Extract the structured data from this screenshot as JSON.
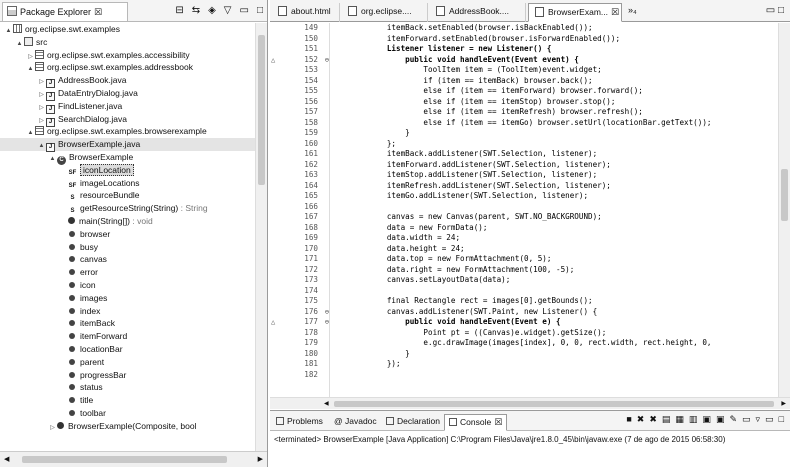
{
  "package_explorer": {
    "title": "Package Explorer",
    "tree": [
      {
        "indent": 0,
        "arrow": "▲",
        "icon": "proj",
        "label": "org.eclipse.swt.examples"
      },
      {
        "indent": 1,
        "arrow": "▲",
        "icon": "src",
        "label": "src"
      },
      {
        "indent": 2,
        "arrow": "▷",
        "icon": "pkg",
        "label": "org.eclipse.swt.examples.accessibility"
      },
      {
        "indent": 2,
        "arrow": "▲",
        "icon": "pkg",
        "label": "org.eclipse.swt.examples.addressbook"
      },
      {
        "indent": 3,
        "arrow": "▷",
        "icon": "file",
        "label": "AddressBook.java"
      },
      {
        "indent": 3,
        "arrow": "▷",
        "icon": "file",
        "label": "DataEntryDialog.java"
      },
      {
        "indent": 3,
        "arrow": "▷",
        "icon": "file",
        "label": "FindListener.java"
      },
      {
        "indent": 3,
        "arrow": "▷",
        "icon": "file",
        "label": "SearchDialog.java"
      },
      {
        "indent": 2,
        "arrow": "▲",
        "icon": "pkg",
        "label": "org.eclipse.swt.examples.browserexample"
      },
      {
        "indent": 3,
        "arrow": "▲",
        "icon": "file",
        "label": "BrowserExample.java",
        "selected": true
      },
      {
        "indent": 4,
        "arrow": "▲",
        "icon": "cls",
        "label": "BrowserExample"
      },
      {
        "indent": 5,
        "arrow": "",
        "icon": "fld2",
        "glyph": "SF",
        "label": "iconLocation",
        "highlight": true
      },
      {
        "indent": 5,
        "arrow": "",
        "icon": "fld2",
        "glyph": "SF",
        "label": "imageLocations"
      },
      {
        "indent": 5,
        "arrow": "",
        "icon": "fld2",
        "glyph": "S",
        "label": "resourceBundle"
      },
      {
        "indent": 5,
        "arrow": "",
        "icon": "fld2",
        "glyph": "S",
        "label": "getResourceString(String)",
        "suffix": " : String"
      },
      {
        "indent": 5,
        "arrow": "",
        "icon": "meth",
        "label": "main(String[])",
        "suffix": " : void"
      },
      {
        "indent": 5,
        "arrow": "",
        "icon": "field",
        "label": "browser"
      },
      {
        "indent": 5,
        "arrow": "",
        "icon": "field",
        "label": "busy"
      },
      {
        "indent": 5,
        "arrow": "",
        "icon": "field",
        "label": "canvas"
      },
      {
        "indent": 5,
        "arrow": "",
        "icon": "field",
        "label": "error"
      },
      {
        "indent": 5,
        "arrow": "",
        "icon": "field",
        "label": "icon"
      },
      {
        "indent": 5,
        "arrow": "",
        "icon": "field",
        "label": "images"
      },
      {
        "indent": 5,
        "arrow": "",
        "icon": "field",
        "label": "index"
      },
      {
        "indent": 5,
        "arrow": "",
        "icon": "field",
        "label": "itemBack"
      },
      {
        "indent": 5,
        "arrow": "",
        "icon": "field",
        "label": "itemForward"
      },
      {
        "indent": 5,
        "arrow": "",
        "icon": "field",
        "label": "locationBar"
      },
      {
        "indent": 5,
        "arrow": "",
        "icon": "field",
        "label": "parent"
      },
      {
        "indent": 5,
        "arrow": "",
        "icon": "field",
        "label": "progressBar"
      },
      {
        "indent": 5,
        "arrow": "",
        "icon": "field",
        "label": "status"
      },
      {
        "indent": 5,
        "arrow": "",
        "icon": "field",
        "label": "title"
      },
      {
        "indent": 5,
        "arrow": "",
        "icon": "field",
        "label": "toolbar"
      },
      {
        "indent": 4,
        "arrow": "▷",
        "icon": "meth",
        "label": "BrowserExample(Composite, bool"
      }
    ]
  },
  "editor": {
    "tabs": [
      {
        "label": "about.html",
        "active": false
      },
      {
        "label": "org.eclipse....",
        "active": false
      },
      {
        "label": "AddressBook....",
        "active": false
      },
      {
        "label": "BrowserExam...",
        "active": true
      }
    ],
    "overflow": "»₄",
    "lines": [
      {
        "n": "149",
        "text": "            itemBack.setEnabled(browser.isBackEnabled());"
      },
      {
        "n": "150",
        "text": "            itemForward.setEnabled(browser.isForwardEnabled());"
      },
      {
        "n": "151",
        "text": "            Listener listener = new Listener() {",
        "bold": true
      },
      {
        "n": "152",
        "mark": "△",
        "fold": "⊖",
        "text": "                public void handleEvent(Event event) {",
        "bold": true
      },
      {
        "n": "153",
        "text": "                    ToolItem item = (ToolItem)event.widget;"
      },
      {
        "n": "154",
        "text": "                    if (item == itemBack) browser.back();"
      },
      {
        "n": "155",
        "text": "                    else if (item == itemForward) browser.forward();"
      },
      {
        "n": "156",
        "text": "                    else if (item == itemStop) browser.stop();"
      },
      {
        "n": "157",
        "text": "                    else if (item == itemRefresh) browser.refresh();"
      },
      {
        "n": "158",
        "text": "                    else if (item == itemGo) browser.setUrl(locationBar.getText());"
      },
      {
        "n": "159",
        "text": "                }"
      },
      {
        "n": "160",
        "text": "            };"
      },
      {
        "n": "161",
        "text": "            itemBack.addListener(SWT.Selection, listener);"
      },
      {
        "n": "162",
        "text": "            itemForward.addListener(SWT.Selection, listener);"
      },
      {
        "n": "163",
        "text": "            itemStop.addListener(SWT.Selection, listener);"
      },
      {
        "n": "164",
        "text": "            itemRefresh.addListener(SWT.Selection, listener);"
      },
      {
        "n": "165",
        "text": "            itemGo.addListener(SWT.Selection, listener);"
      },
      {
        "n": "166",
        "text": ""
      },
      {
        "n": "167",
        "text": "            canvas = new Canvas(parent, SWT.NO_BACKGROUND);"
      },
      {
        "n": "168",
        "text": "            data = new FormData();"
      },
      {
        "n": "169",
        "text": "            data.width = 24;"
      },
      {
        "n": "170",
        "text": "            data.height = 24;"
      },
      {
        "n": "171",
        "text": "            data.top = new FormAttachment(0, 5);"
      },
      {
        "n": "172",
        "text": "            data.right = new FormAttachment(100, -5);"
      },
      {
        "n": "173",
        "text": "            canvas.setLayoutData(data);"
      },
      {
        "n": "174",
        "text": ""
      },
      {
        "n": "175",
        "text": "            final Rectangle rect = images[0].getBounds();"
      },
      {
        "n": "176",
        "fold": "⊖",
        "text": "            canvas.addListener(SWT.Paint, new Listener() {"
      },
      {
        "n": "177",
        "mark": "△",
        "fold": "⊖",
        "text": "                public void handleEvent(Event e) {",
        "bold": true
      },
      {
        "n": "178",
        "text": "                    Point pt = ((Canvas)e.widget).getSize();"
      },
      {
        "n": "179",
        "text": "                    e.gc.drawImage(images[index], 0, 0, rect.width, rect.height, 0,"
      },
      {
        "n": "180",
        "text": "                }"
      },
      {
        "n": "181",
        "text": "            });"
      },
      {
        "n": "182",
        "text": ""
      }
    ]
  },
  "console": {
    "tabs": [
      {
        "label": "Problems",
        "active": false
      },
      {
        "label": "Javadoc",
        "active": false
      },
      {
        "label": "Declaration",
        "active": false
      },
      {
        "label": "Console",
        "active": true
      }
    ],
    "status": "<terminated> BrowserExample [Java Application] C:\\Program Files\\Java\\jre1.8.0_45\\bin\\javaw.exe (7 de ago de 2015 06:58:30)"
  }
}
